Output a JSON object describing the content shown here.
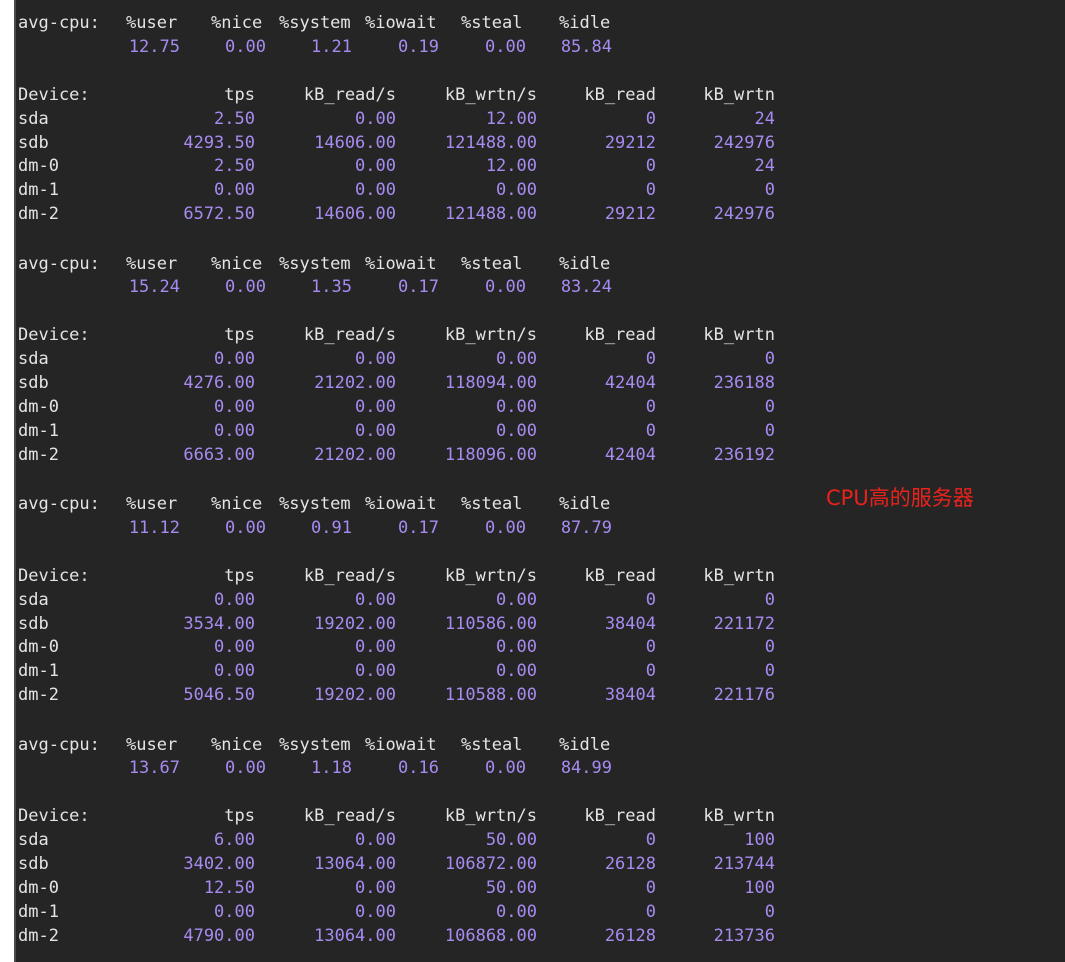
{
  "colors": {
    "background": "#252525",
    "label": "#e4e4e4",
    "number": "#a78bf0",
    "annotation": "#e8231c"
  },
  "annotation": "CPU高的服务器",
  "cpu_headers": [
    "avg-cpu:",
    "%user",
    "%nice",
    "%system",
    "%iowait",
    "%steal",
    "%idle"
  ],
  "device_headers": [
    "Device:",
    "tps",
    "kB_read/s",
    "kB_wrtn/s",
    "kB_read",
    "kB_wrtn"
  ],
  "samples": [
    {
      "cpu": [
        "12.75",
        "0.00",
        "1.21",
        "0.19",
        "0.00",
        "85.84"
      ],
      "devices": [
        [
          "sda",
          "2.50",
          "0.00",
          "12.00",
          "0",
          "24"
        ],
        [
          "sdb",
          "4293.50",
          "14606.00",
          "121488.00",
          "29212",
          "242976"
        ],
        [
          "dm-0",
          "2.50",
          "0.00",
          "12.00",
          "0",
          "24"
        ],
        [
          "dm-1",
          "0.00",
          "0.00",
          "0.00",
          "0",
          "0"
        ],
        [
          "dm-2",
          "6572.50",
          "14606.00",
          "121488.00",
          "29212",
          "242976"
        ]
      ]
    },
    {
      "cpu": [
        "15.24",
        "0.00",
        "1.35",
        "0.17",
        "0.00",
        "83.24"
      ],
      "devices": [
        [
          "sda",
          "0.00",
          "0.00",
          "0.00",
          "0",
          "0"
        ],
        [
          "sdb",
          "4276.00",
          "21202.00",
          "118094.00",
          "42404",
          "236188"
        ],
        [
          "dm-0",
          "0.00",
          "0.00",
          "0.00",
          "0",
          "0"
        ],
        [
          "dm-1",
          "0.00",
          "0.00",
          "0.00",
          "0",
          "0"
        ],
        [
          "dm-2",
          "6663.00",
          "21202.00",
          "118096.00",
          "42404",
          "236192"
        ]
      ]
    },
    {
      "cpu": [
        "11.12",
        "0.00",
        "0.91",
        "0.17",
        "0.00",
        "87.79"
      ],
      "devices": [
        [
          "sda",
          "0.00",
          "0.00",
          "0.00",
          "0",
          "0"
        ],
        [
          "sdb",
          "3534.00",
          "19202.00",
          "110586.00",
          "38404",
          "221172"
        ],
        [
          "dm-0",
          "0.00",
          "0.00",
          "0.00",
          "0",
          "0"
        ],
        [
          "dm-1",
          "0.00",
          "0.00",
          "0.00",
          "0",
          "0"
        ],
        [
          "dm-2",
          "5046.50",
          "19202.00",
          "110588.00",
          "38404",
          "221176"
        ]
      ]
    },
    {
      "cpu": [
        "13.67",
        "0.00",
        "1.18",
        "0.16",
        "0.00",
        "84.99"
      ],
      "devices": [
        [
          "sda",
          "6.00",
          "0.00",
          "50.00",
          "0",
          "100"
        ],
        [
          "sdb",
          "3402.00",
          "13064.00",
          "106872.00",
          "26128",
          "213744"
        ],
        [
          "dm-0",
          "12.50",
          "0.00",
          "50.00",
          "0",
          "100"
        ],
        [
          "dm-1",
          "0.00",
          "0.00",
          "0.00",
          "0",
          "0"
        ],
        [
          "dm-2",
          "4790.00",
          "13064.00",
          "106868.00",
          "26128",
          "213736"
        ]
      ]
    }
  ]
}
